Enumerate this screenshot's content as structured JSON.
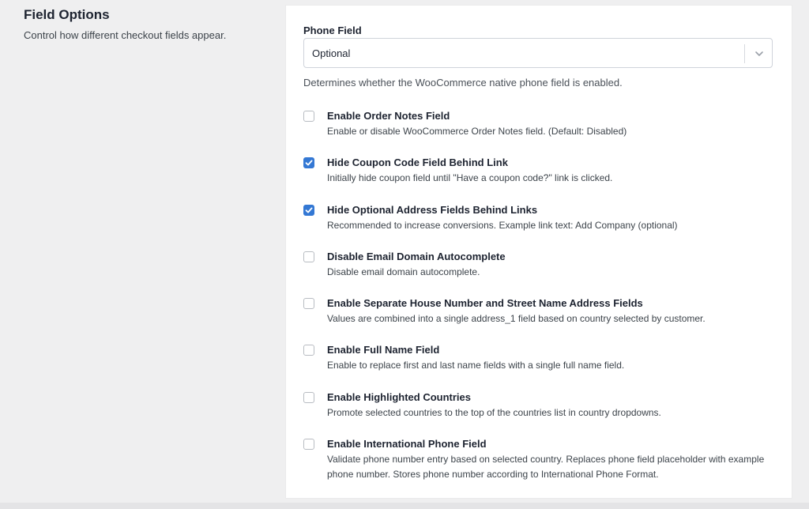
{
  "section": {
    "title": "Field Options",
    "description": "Control how different checkout fields appear."
  },
  "phone_field": {
    "label": "Phone Field",
    "selected_value": "Optional",
    "help_text": "Determines whether the WooCommerce native phone field is enabled."
  },
  "options": [
    {
      "title": "Enable Order Notes Field",
      "description": "Enable or disable WooCommerce Order Notes field. (Default: Disabled)",
      "checked": false
    },
    {
      "title": "Hide Coupon Code Field Behind Link",
      "description": "Initially hide coupon field until \"Have a coupon code?\" link is clicked.",
      "checked": true
    },
    {
      "title": "Hide Optional Address Fields Behind Links",
      "description": "Recommended to increase conversions. Example link text: Add Company (optional)",
      "checked": true
    },
    {
      "title": "Disable Email Domain Autocomplete",
      "description": "Disable email domain autocomplete.",
      "checked": false
    },
    {
      "title": "Enable Separate House Number and Street Name Address Fields",
      "description": "Values are combined into a single address_1 field based on country selected by customer.",
      "checked": false
    },
    {
      "title": "Enable Full Name Field",
      "description": "Enable to replace first and last name fields with a single full name field.",
      "checked": false
    },
    {
      "title": "Enable Highlighted Countries",
      "description": "Promote selected countries to the top of the countries list in country dropdowns.",
      "checked": false
    },
    {
      "title": "Enable International Phone Field",
      "description": "Validate phone number entry based on selected country. Replaces phone field placeholder with example phone number. Stores phone number according to International Phone Format.",
      "checked": false
    }
  ],
  "colors": {
    "accent": "#3478d4",
    "background": "#efeff0",
    "card": "#ffffff"
  }
}
